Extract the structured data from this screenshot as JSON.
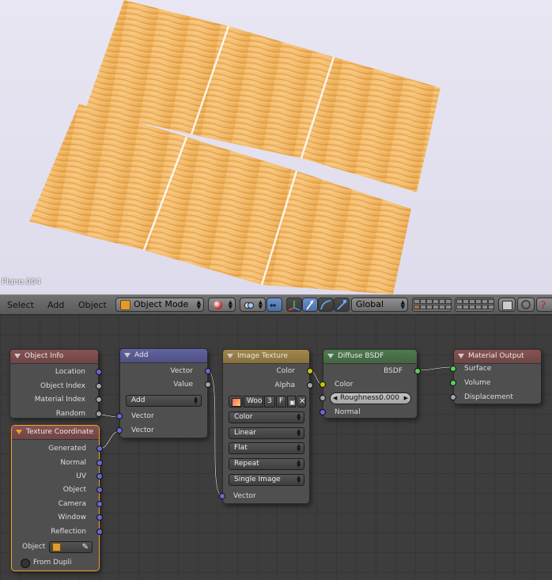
{
  "viewport": {
    "object_label": "Plane.004"
  },
  "header": {
    "menus": [
      "Select",
      "Add",
      "Object"
    ],
    "mode": "Object Mode",
    "orientation": "Global"
  },
  "nodes": {
    "object_info": {
      "title": "Object Info",
      "outputs": [
        "Location",
        "Object Index",
        "Material Index",
        "Random"
      ]
    },
    "add": {
      "title": "Add",
      "outputs": [
        "Vector",
        "Value"
      ],
      "operation": "Add",
      "inputs": [
        "Vector",
        "Vector"
      ]
    },
    "image_texture": {
      "title": "Image Texture",
      "outputs": [
        "Color",
        "Alpha"
      ],
      "image_name": "Woo",
      "users": "3",
      "fake_user": "F",
      "color_space": "Color",
      "interpolation": "Linear",
      "projection": "Flat",
      "extension": "Repeat",
      "source": "Single Image",
      "inputs": [
        "Vector"
      ]
    },
    "diffuse": {
      "title": "Diffuse BSDF",
      "outputs": [
        "BSDF"
      ],
      "color_label": "Color",
      "roughness_label": "Roughness:",
      "roughness_value": "0.000",
      "normal_label": "Normal"
    },
    "material_output": {
      "title": "Material Output",
      "inputs": [
        "Surface",
        "Volume",
        "Displacement"
      ]
    },
    "texture_coordinate": {
      "title": "Texture Coordinate",
      "outputs": [
        "Generated",
        "Normal",
        "UV",
        "Object",
        "Camera",
        "Window",
        "Reflection"
      ],
      "object_label": "Object",
      "from_dupli": "From Dupli"
    }
  },
  "colors": {
    "vector_socket": "#6868d8",
    "value_socket": "#a3a3a3",
    "color_socket": "#c8c800",
    "shader_socket": "#5ad05a",
    "active_node_border": "#f0a030",
    "wood": "#f0b560"
  }
}
